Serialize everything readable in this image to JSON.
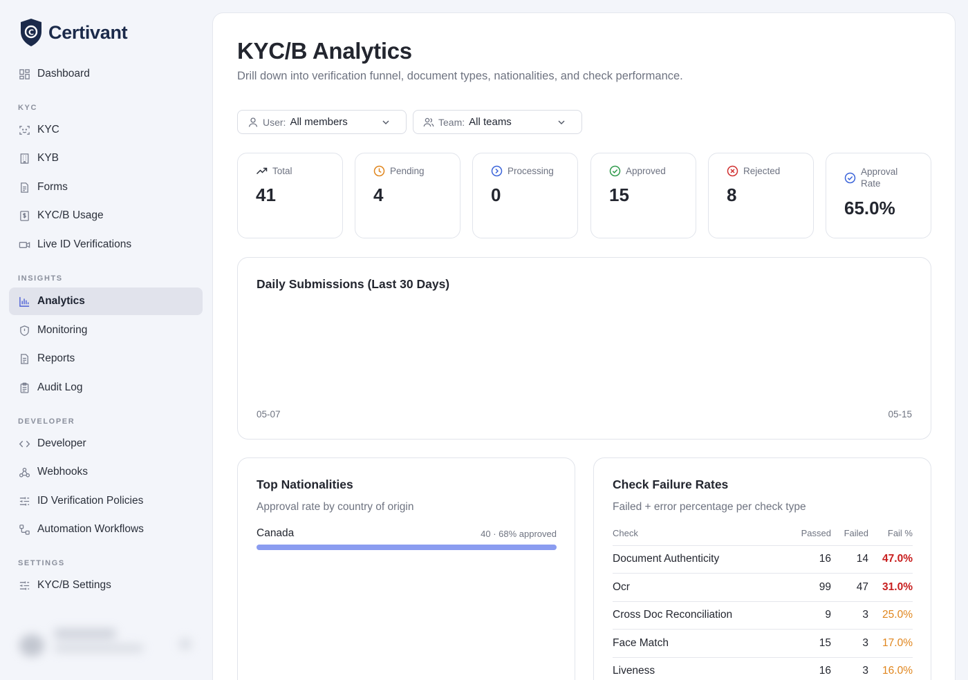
{
  "brand": {
    "name": "Certivant",
    "logo_letter": "C"
  },
  "sidebar": {
    "top_items": [
      {
        "label": "Dashboard",
        "icon": "grid-icon"
      }
    ],
    "sections": [
      {
        "title": "KYC",
        "items": [
          {
            "label": "KYC",
            "icon": "face-scan-icon"
          },
          {
            "label": "KYB",
            "icon": "building-icon"
          },
          {
            "label": "Forms",
            "icon": "document-icon"
          },
          {
            "label": "KYC/B Usage",
            "icon": "dollar-receipt-icon"
          },
          {
            "label": "Live ID Verifications",
            "icon": "video-icon"
          }
        ]
      },
      {
        "title": "INSIGHTS",
        "items": [
          {
            "label": "Analytics",
            "icon": "bar-chart-icon",
            "active": true
          },
          {
            "label": "Monitoring",
            "icon": "shield-icon"
          },
          {
            "label": "Reports",
            "icon": "report-icon"
          },
          {
            "label": "Audit Log",
            "icon": "clipboard-icon"
          }
        ]
      },
      {
        "title": "DEVELOPER",
        "items": [
          {
            "label": "Developer",
            "icon": "code-icon"
          },
          {
            "label": "Webhooks",
            "icon": "webhook-icon"
          },
          {
            "label": "ID Verification Policies",
            "icon": "sliders-icon"
          },
          {
            "label": "Automation Workflows",
            "icon": "workflow-icon"
          }
        ]
      },
      {
        "title": "SETTINGS",
        "items": [
          {
            "label": "KYC/B Settings",
            "icon": "sliders-icon"
          }
        ]
      }
    ]
  },
  "header": {
    "title": "KYC/B Analytics",
    "subtitle": "Drill down into verification funnel, document types, nationalities, and check performance."
  },
  "filters": {
    "user": {
      "key": "User:",
      "value": "All members"
    },
    "team": {
      "key": "Team:",
      "value": "All teams"
    }
  },
  "stats": [
    {
      "label": "Total",
      "value": "41",
      "icon": "trending-up-icon",
      "color": "#2a2f3a"
    },
    {
      "label": "Pending",
      "value": "4",
      "icon": "clock-icon",
      "color": "#e0851c"
    },
    {
      "label": "Processing",
      "value": "0",
      "icon": "processing-icon",
      "color": "#3a63d9"
    },
    {
      "label": "Approved",
      "value": "15",
      "icon": "check-circle-icon",
      "color": "#2f9a4b"
    },
    {
      "label": "Rejected",
      "value": "8",
      "icon": "x-circle-icon",
      "color": "#d02f2f"
    },
    {
      "label": "Approval Rate",
      "value": "65.0%",
      "icon": "check-circle-icon",
      "color": "#3a63d9"
    }
  ],
  "daily_chart": {
    "title": "Daily Submissions (Last 30 Days)",
    "x_start": "05-07",
    "x_end": "05-15"
  },
  "nationalities": {
    "title": "Top Nationalities",
    "subtitle": "Approval rate by country of origin",
    "rows": [
      {
        "country": "Canada",
        "meta": "40 · 68% approved",
        "count": 40,
        "approval_pct": 68,
        "bar_fraction": 1.0
      }
    ]
  },
  "check_failures": {
    "title": "Check Failure Rates",
    "subtitle": "Failed + error percentage per check type",
    "columns": [
      "Check",
      "Passed",
      "Failed",
      "Fail %"
    ],
    "rows": [
      {
        "check": "Document Authenticity",
        "passed": "16",
        "failed": "14",
        "fail_pct": "47.0%",
        "severity_color": "#c81e1e",
        "bold": true
      },
      {
        "check": "Ocr",
        "passed": "99",
        "failed": "47",
        "fail_pct": "31.0%",
        "severity_color": "#c81e1e",
        "bold": true
      },
      {
        "check": "Cross Doc Reconciliation",
        "passed": "9",
        "failed": "3",
        "fail_pct": "25.0%",
        "severity_color": "#e0851c",
        "bold": false
      },
      {
        "check": "Face Match",
        "passed": "15",
        "failed": "3",
        "fail_pct": "17.0%",
        "severity_color": "#e0851c",
        "bold": false
      },
      {
        "check": "Liveness",
        "passed": "16",
        "failed": "3",
        "fail_pct": "16.0%",
        "severity_color": "#e0851c",
        "bold": false
      }
    ]
  }
}
